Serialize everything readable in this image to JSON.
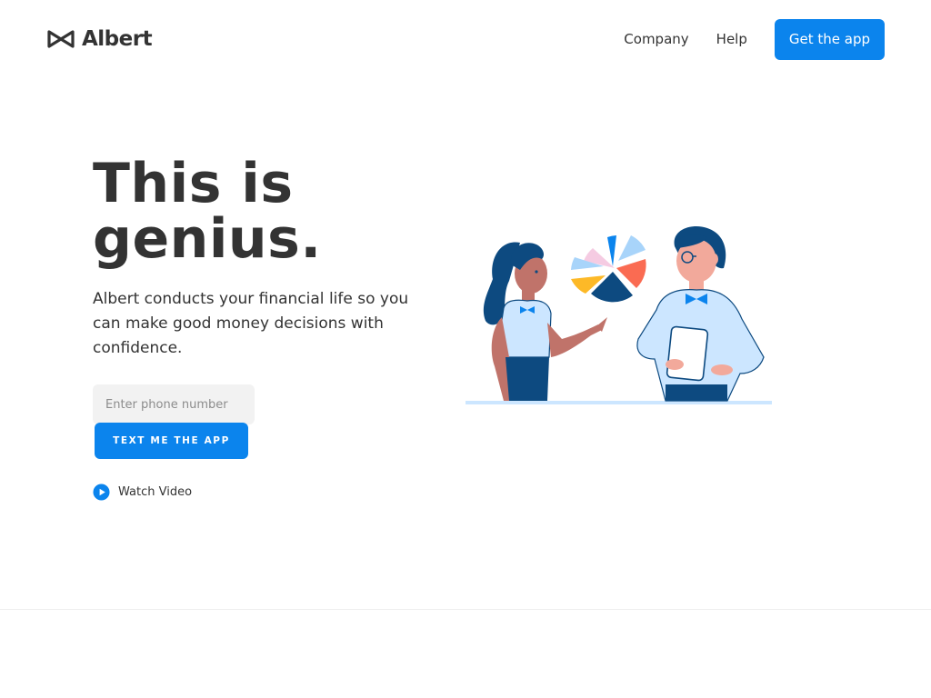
{
  "brand": {
    "name": "Albert",
    "logo_icon": "bowtie-logo-icon"
  },
  "nav": {
    "items": [
      {
        "label": "Company"
      },
      {
        "label": "Help"
      }
    ],
    "cta_label": "Get the app"
  },
  "hero": {
    "title": "This is genius.",
    "subtitle": "Albert conducts your financial life so you can make good money decisions with confidence.",
    "phone_placeholder": "Enter phone number",
    "phone_value": "",
    "submit_label": "TEXT ME THE APP",
    "video_link_label": "Watch Video",
    "video_icon": "play-circle-icon",
    "illustration": "two-people-pie-chart-illustration"
  },
  "colors": {
    "accent": "#0b84ed",
    "text": "#333333",
    "input_bg": "#f2f2f2",
    "navy": "#0d4a80",
    "light_blue": "#cce6ff",
    "skin": "#f2a99b",
    "skin_dark": "#c0736a",
    "yellow": "#fdb927",
    "coral": "#fa6b52",
    "pink": "#f5cbe2"
  }
}
